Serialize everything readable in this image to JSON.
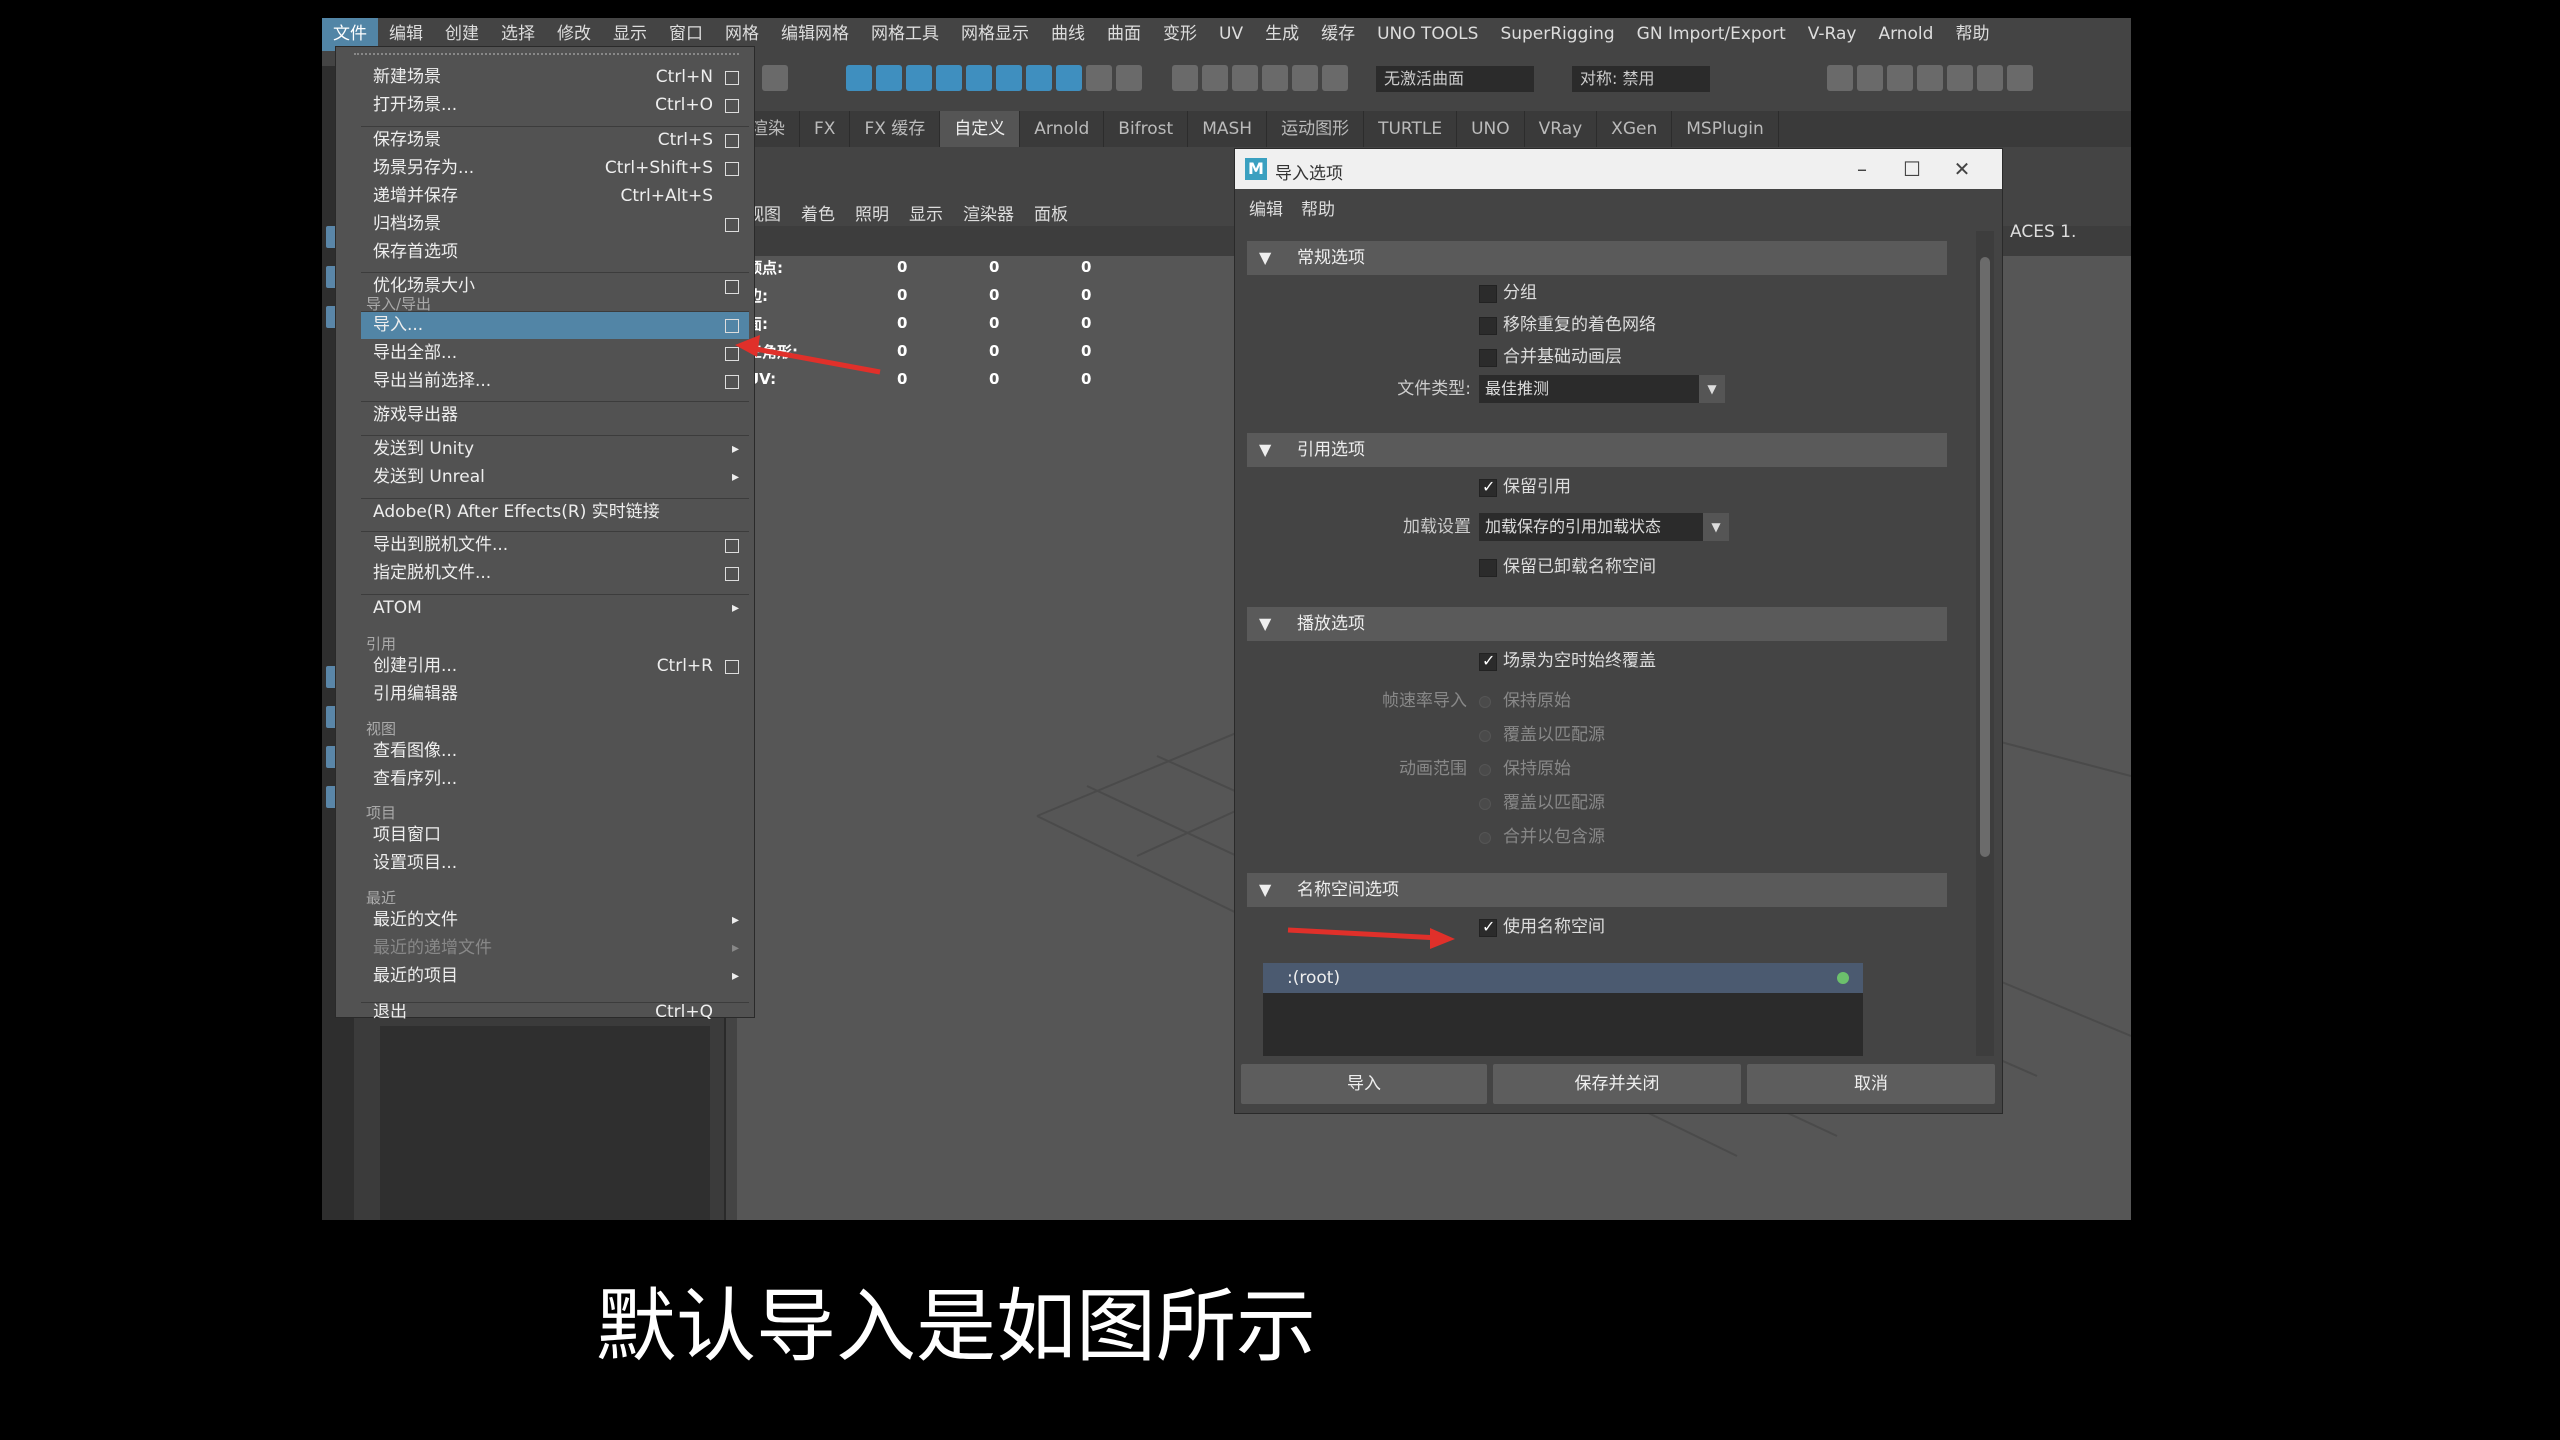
{
  "menubar": [
    "文件",
    "编辑",
    "创建",
    "选择",
    "修改",
    "显示",
    "窗口",
    "网格",
    "编辑网格",
    "网格工具",
    "网格显示",
    "曲线",
    "曲面",
    "变形",
    "UV",
    "生成",
    "缓存",
    "UNO TOOLS",
    "SuperRigging",
    "GN Import/Export",
    "V-Ray",
    "Arnold",
    "帮助"
  ],
  "toolbar": {
    "field1": "无激活曲面",
    "field2": "对称: 禁用"
  },
  "shelf_tabs": [
    "渲染",
    "FX",
    "FX 缓存",
    "自定义",
    "Arnold",
    "Bifrost",
    "MASH",
    "运动图形",
    "TURTLE",
    "UNO",
    "VRay",
    "XGen",
    "MSPlugin"
  ],
  "panel_menu": [
    "视图",
    "着色",
    "照明",
    "显示",
    "渲染器",
    "面板"
  ],
  "hud": {
    "rows": [
      {
        "label": "顶点:",
        "values": [
          "0",
          "0",
          "0"
        ]
      },
      {
        "label": "边:",
        "values": [
          "0",
          "0",
          "0"
        ]
      },
      {
        "label": "面:",
        "values": [
          "0",
          "0",
          "0"
        ]
      },
      {
        "label": "三角形:",
        "values": [
          "0",
          "0",
          "0"
        ]
      },
      {
        "label": "UV:",
        "values": [
          "0",
          "0",
          "0"
        ]
      }
    ]
  },
  "aces": "ACES 1.",
  "filemenu": {
    "items": [
      {
        "label": "新建场景",
        "short": "Ctrl+N",
        "box": true
      },
      {
        "label": "打开场景...",
        "short": "Ctrl+O",
        "box": true
      },
      {
        "label": "保存场景",
        "short": "Ctrl+S",
        "box": true
      },
      {
        "label": "场景另存为...",
        "short": "Ctrl+Shift+S",
        "box": true
      },
      {
        "label": "递增并保存",
        "short": "Ctrl+Alt+S",
        "box": false
      },
      {
        "label": "归档场景",
        "short": "",
        "box": true
      },
      {
        "label": "保存首选项",
        "short": "",
        "box": false
      },
      {
        "label": "优化场景大小",
        "short": "",
        "box": true
      },
      {
        "label": "导入...",
        "short": "",
        "box": true
      },
      {
        "label": "导出全部...",
        "short": "",
        "box": true
      },
      {
        "label": "导出当前选择...",
        "short": "",
        "box": true
      },
      {
        "label": "游戏导出器",
        "short": "",
        "box": false
      },
      {
        "label": "发送到 Unity",
        "short": "",
        "box": false,
        "arrow": "▸"
      },
      {
        "label": "发送到 Unreal",
        "short": "",
        "box": false,
        "arrow": "▸"
      },
      {
        "label": "Adobe(R) After Effects(R) 实时链接",
        "short": "",
        "box": false
      },
      {
        "label": "导出到脱机文件...",
        "short": "",
        "box": true
      },
      {
        "label": "指定脱机文件...",
        "short": "",
        "box": true
      },
      {
        "label": "ATOM",
        "short": "",
        "box": false,
        "arrow": "▸"
      },
      {
        "label": "创建引用...",
        "short": "Ctrl+R",
        "box": true
      },
      {
        "label": "引用编辑器",
        "short": "",
        "box": false
      },
      {
        "label": "查看图像...",
        "short": "",
        "box": false
      },
      {
        "label": "查看序列...",
        "short": "",
        "box": false
      },
      {
        "label": "项目窗口",
        "short": "",
        "box": false
      },
      {
        "label": "设置项目...",
        "short": "",
        "box": false
      },
      {
        "label": "最近的文件",
        "short": "",
        "box": false,
        "arrow": "▸"
      },
      {
        "label": "最近的递增文件",
        "short": "",
        "box": false,
        "arrow": "▸"
      },
      {
        "label": "最近的项目",
        "short": "",
        "box": false,
        "arrow": "▸"
      },
      {
        "label": "退出",
        "short": "Ctrl+Q",
        "box": false
      }
    ],
    "sections": [
      "导入/导出",
      "引用",
      "视图",
      "项目",
      "最近"
    ]
  },
  "dialog": {
    "title": "导入选项",
    "menu": [
      "编辑",
      "帮助"
    ],
    "general": {
      "header": "常规选项",
      "group": "分组",
      "remove_dup": "移除重复的着色网络",
      "merge_anim": "合并基础动画层",
      "filetype_label": "文件类型:",
      "filetype_value": "最佳推测"
    },
    "reference": {
      "header": "引用选项",
      "keep_ref": "保留引用",
      "load_label": "加载设置",
      "load_value": "加载保存的引用加载状态",
      "keep_unloaded": "保留已卸载名称空间"
    },
    "playback": {
      "header": "播放选项",
      "override": "场景为空时始终覆盖",
      "fps_label": "帧速率导入",
      "fps_keep": "保持原始",
      "fps_match": "覆盖以匹配源",
      "anim_label": "动画范围",
      "anim_keep": "保持原始",
      "anim_match": "覆盖以匹配源",
      "anim_merge": "合并以包含源"
    },
    "namespace": {
      "header": "名称空间选项",
      "use_ns": "使用名称空间",
      "root": ":(root)"
    },
    "buttons": {
      "import": "导入",
      "save_close": "保存并关闭",
      "cancel": "取消"
    }
  },
  "subtitle": "默认导入是如图所示",
  "colors": {
    "highlight": "#5285a6",
    "arrow": "#e0302a"
  }
}
